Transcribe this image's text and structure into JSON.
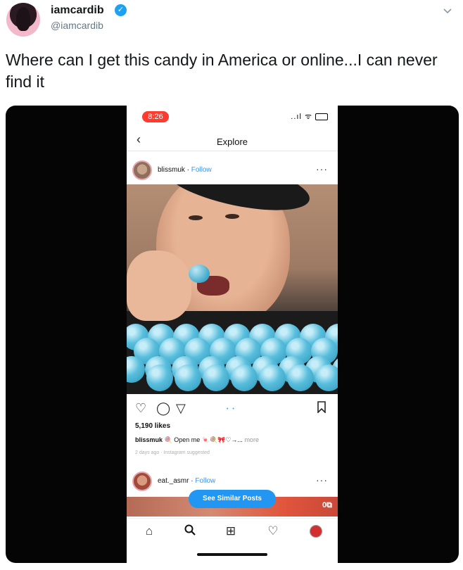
{
  "tweet": {
    "display_name": "iamcardib",
    "verified_mark": "✓",
    "handle": "@iamcardib",
    "text": "Where can I get this candy in America or online...I can never find it"
  },
  "phone": {
    "time": "8:26",
    "status_icons": "..ıl ᯤ",
    "nav_title": "Explore",
    "back_glyph": "‹",
    "post": {
      "username": "blissmuk",
      "follow_sep": " · ",
      "follow": "Follow",
      "more": "···",
      "likes": "5,190 likes",
      "caption_user": "blissmuk",
      "caption_text": " 🍭 Open me 🍬🍭🎀♡→...",
      "caption_more": " more",
      "meta": "2 days ago · Instagram suggested",
      "pager": "• •"
    },
    "post2": {
      "username": "eat._asmr",
      "follow_sep": " · ",
      "follow": "Follow",
      "more": "···"
    },
    "see_similar": "See Similar Posts",
    "corner_badge": "0⧉",
    "icons": {
      "like": "♡",
      "comment": "◯",
      "share": "▽",
      "save": "⌑",
      "home": "⌂",
      "search": "⌕",
      "add": "⊞",
      "activity": "♡"
    }
  }
}
